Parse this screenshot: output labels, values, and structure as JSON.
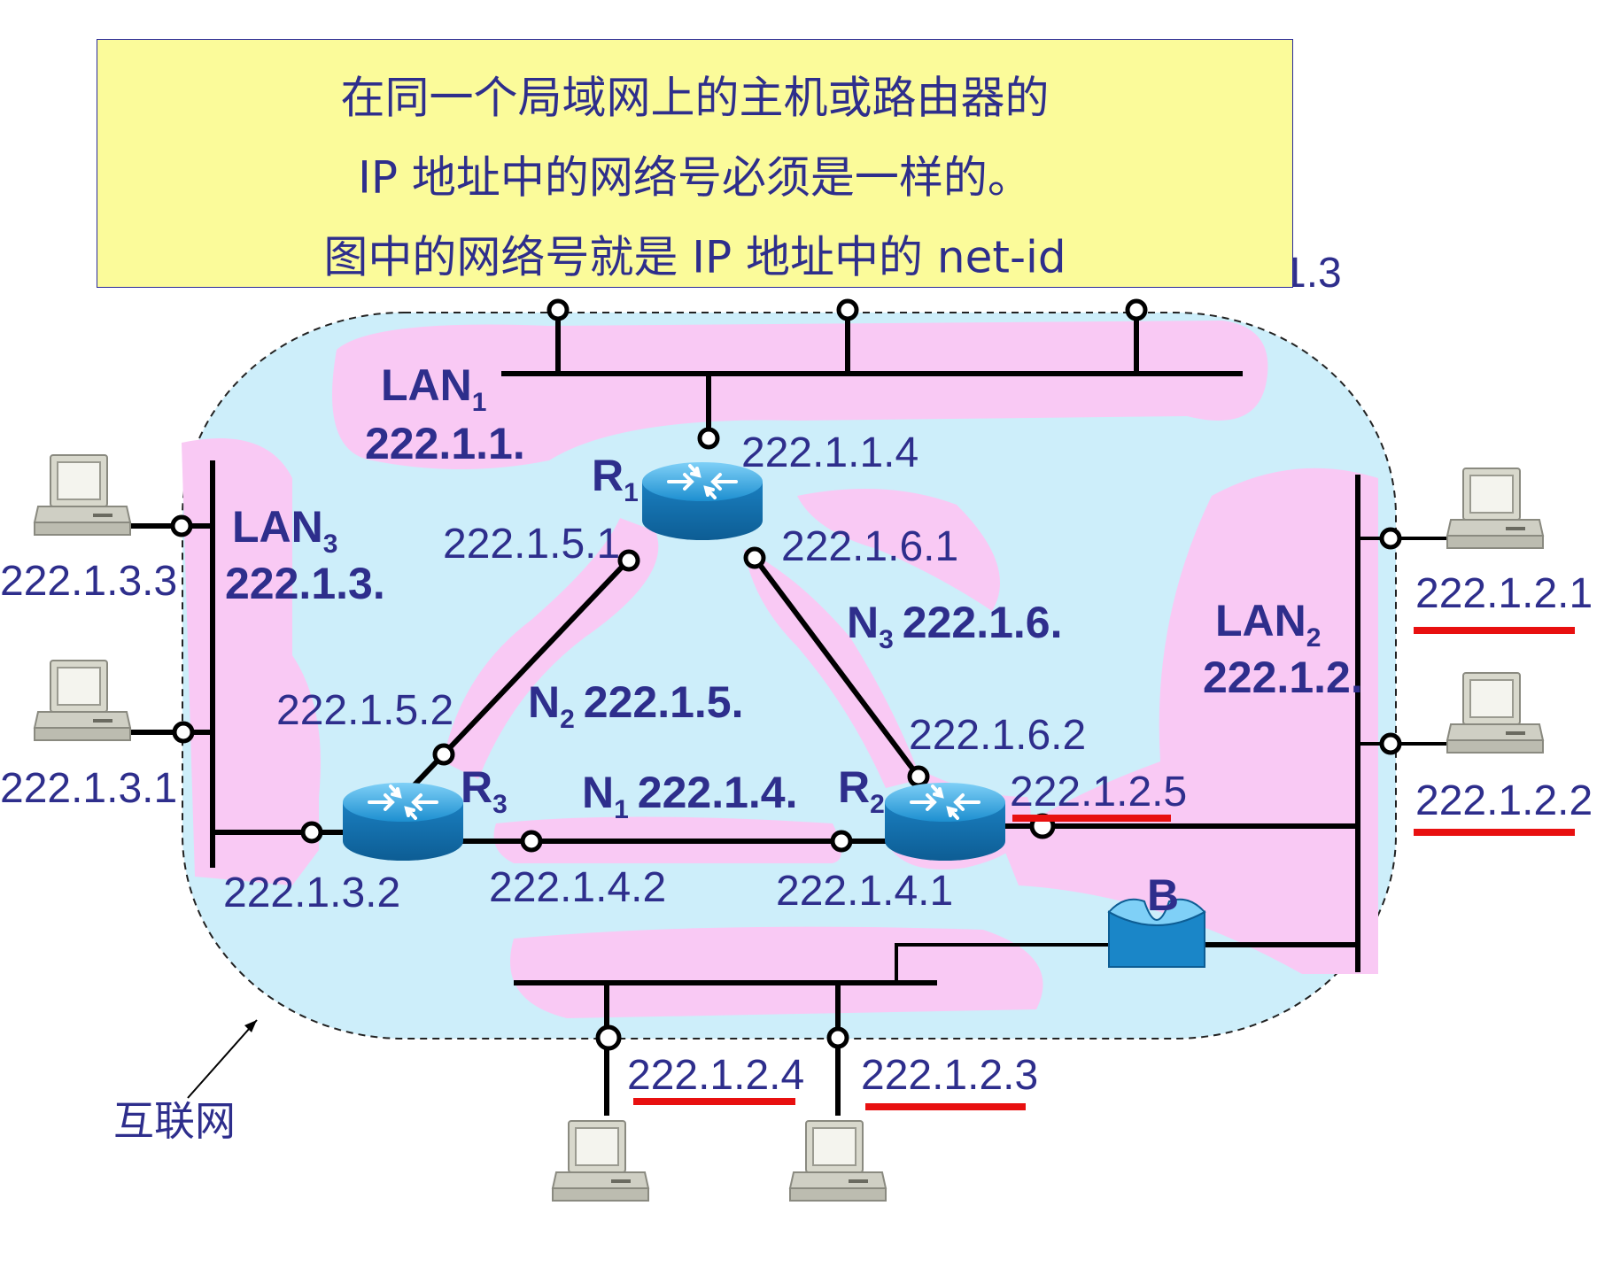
{
  "note": {
    "lines": [
      "在同一个局域网上的主机或路由器的",
      "IP 地址中的网络号必须是一样的。",
      "图中的网络号就是 IP 地址中的 net-id"
    ]
  },
  "networks": {
    "lan1": {
      "name": "LAN",
      "sub": "1",
      "id": "222.1.1."
    },
    "lan2": {
      "name": "LAN",
      "sub": "2",
      "id": "222.1.2."
    },
    "lan3": {
      "name": "LAN",
      "sub": "3",
      "id": "222.1.3."
    },
    "n1": {
      "name": "N",
      "sub": "1",
      "id": "222.1.4."
    },
    "n2": {
      "name": "N",
      "sub": "2",
      "id": "222.1.5."
    },
    "n3": {
      "name": "N",
      "sub": "3",
      "id": "222.1.6."
    }
  },
  "routers": {
    "r1": {
      "name": "R",
      "sub": "1"
    },
    "r2": {
      "name": "R",
      "sub": "2"
    },
    "r3": {
      "name": "R",
      "sub": "3"
    }
  },
  "bridge": {
    "label": "B"
  },
  "internet_label": "互联网",
  "addresses": {
    "lan1_host3": "1.3",
    "r1_lan1": "222.1.1.4",
    "r1_n2": "222.1.5.1",
    "r1_n3": "222.1.6.1",
    "r3_n2": "222.1.5.2",
    "r3_lan3": "222.1.3.2",
    "r3_n1": "222.1.4.2",
    "r2_n1": "222.1.4.1",
    "r2_n3": "222.1.6.2",
    "r2_lan2": "222.1.2.5",
    "lan3_host_a": "222.1.3.3",
    "lan3_host_b": "222.1.3.1",
    "lan2_host_a": "222.1.2.1",
    "lan2_host_b": "222.1.2.2",
    "lan2_host_c": "222.1.2.4",
    "lan2_host_d": "222.1.2.3"
  },
  "colors": {
    "note_bg": "#fbfb9a",
    "cloud": "#cdeefa",
    "highlight": "#f9c9f4",
    "text": "#2e2e8c",
    "underline": "#e81010",
    "router": "#1a86c8",
    "bridge": "#1a86c8"
  }
}
